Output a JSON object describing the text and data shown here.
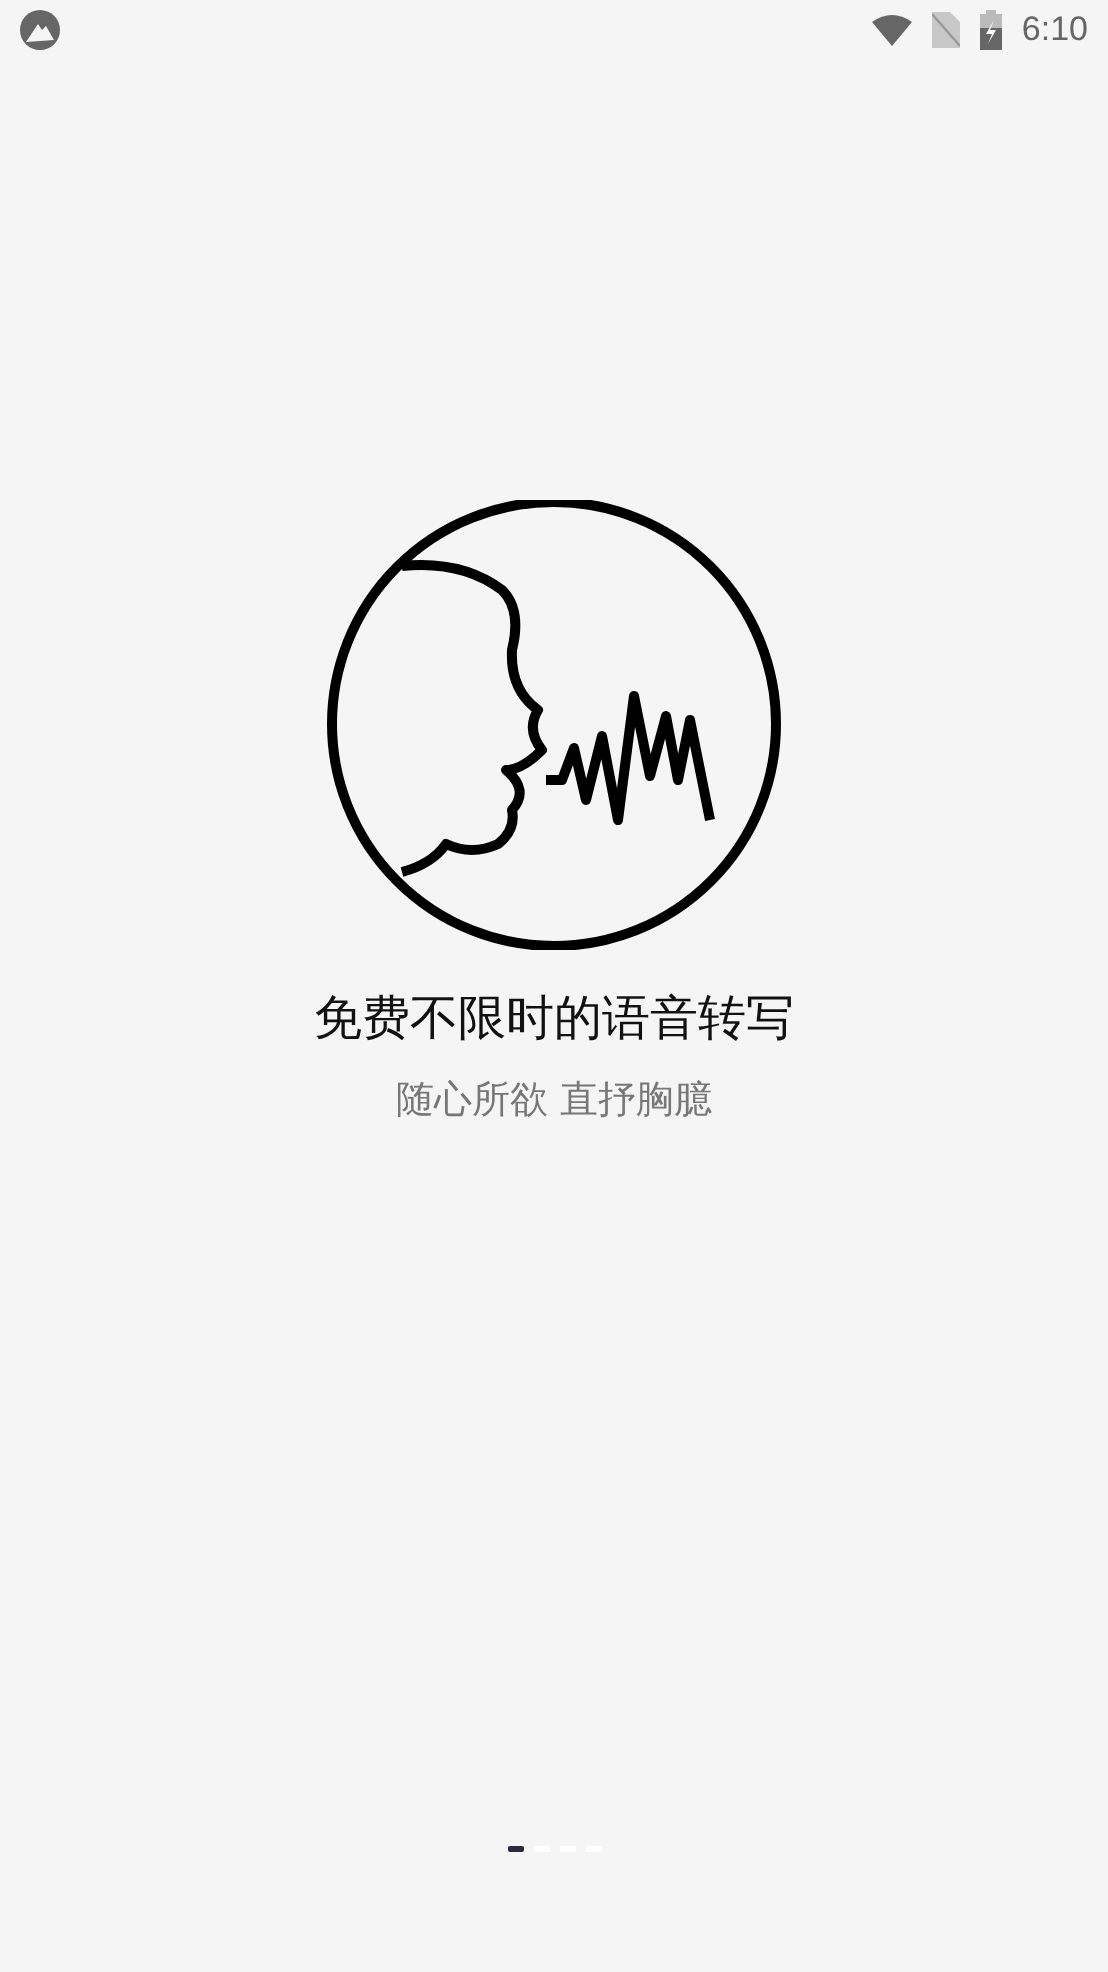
{
  "status_bar": {
    "time": "6:10"
  },
  "title": "免费不限时的语音转写",
  "subtitle": "随心所欲 直抒胸臆",
  "pager": [
    {
      "selected": true
    },
    {
      "selected": false
    },
    {
      "selected": false
    },
    {
      "selected": false
    }
  ]
}
